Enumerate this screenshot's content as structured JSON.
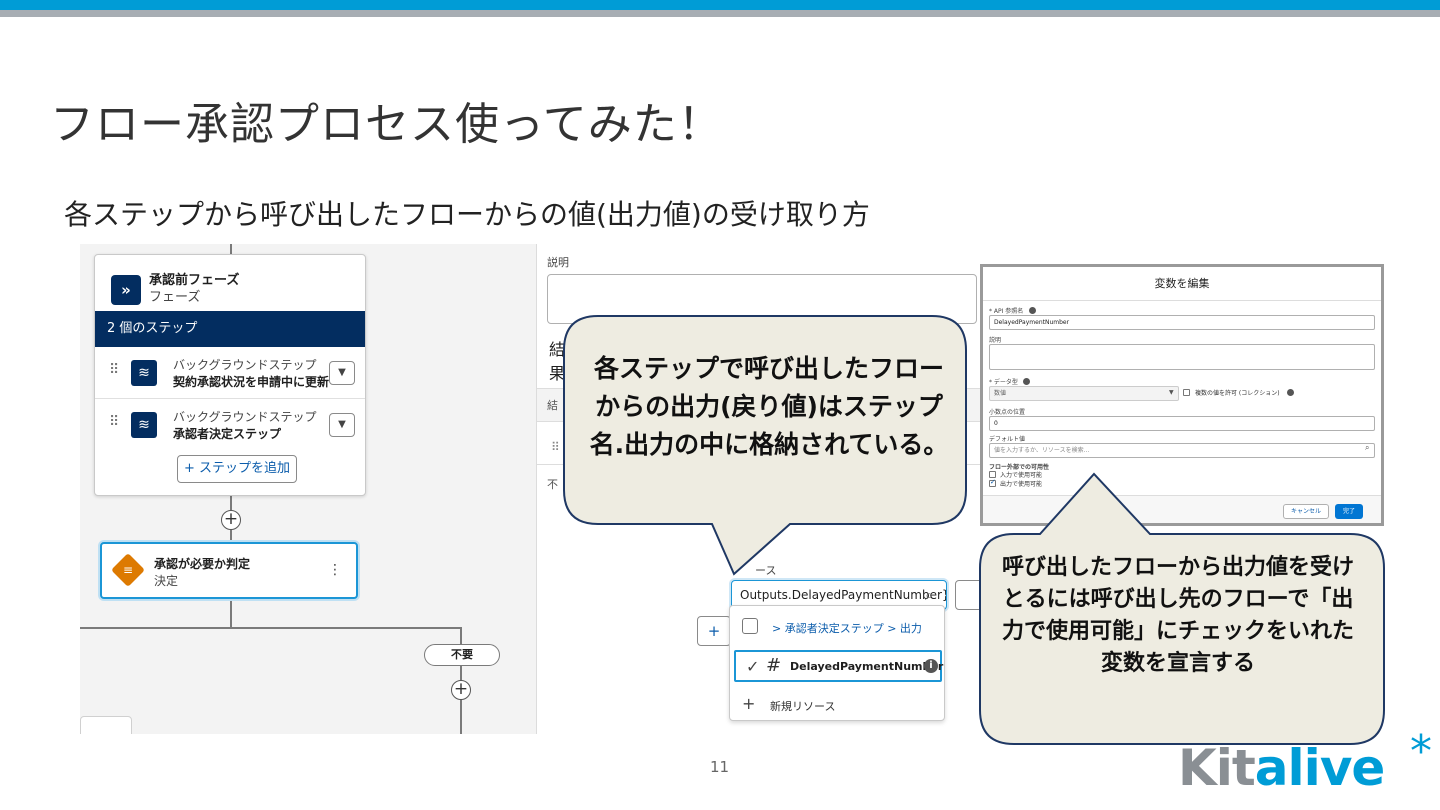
{
  "slide": {
    "title": "フロー承認プロセス使ってみた！",
    "subtitle": "各ステップから呼び出したフローからの値(出力値)の受け取り方",
    "page_number": "11"
  },
  "flow": {
    "phase": {
      "title": "承認前フェーズ",
      "type": "フェーズ",
      "icon": "chevron-double-icon",
      "steps_header": "2 個のステップ",
      "steps": [
        {
          "type": "バックグラウンドステップ",
          "name": "契約承認状況を申請中に更新"
        },
        {
          "type": "バックグラウンドステップ",
          "name": "承認者決定ステップ"
        }
      ],
      "add_step_label": "+ ステップを追加"
    },
    "decision": {
      "title": "承認が必要か判定",
      "type": "決定",
      "menu": "⋮"
    },
    "outcome_label": "不要"
  },
  "properties": {
    "description_label": "説明",
    "result_label_1": "結",
    "result_label_2": "果",
    "result_header": "結",
    "result_row": "不",
    "source_label": "ース",
    "source_value": "Outputs.DelayedPaymentNumber}",
    "add_label": "+",
    "dropdown": {
      "path": "> 承認者決定ステップ > 出力",
      "selected_var": "DelayedPaymentNumber",
      "new_resource": "新規リソース"
    }
  },
  "dialog": {
    "title": "変数を編集",
    "api_name_label": "* API 参照名",
    "api_name_value": "DelayedPaymentNumber",
    "description_label": "説明",
    "data_type_label": "* データ型",
    "data_type_value": "数値",
    "allow_multiple_label": "複数の値を許可 (コレクション)",
    "decimal_label": "小数点の位置",
    "decimal_value": "0",
    "default_label": "デフォルト値",
    "default_placeholder": "値を入力するか、リソースを検索...",
    "availability_label": "フロー外部での可用性",
    "available_input_label": "入力で使用可能",
    "available_output_label": "出力で使用可能",
    "available_input_checked": false,
    "available_output_checked": true,
    "cancel_label": "キャンセル",
    "done_label": "完了"
  },
  "callouts": {
    "callout1": "各ステップで呼び出したフローからの出力(戻り値)はステップ名.出力の中に格納されている。",
    "callout2": "呼び出したフローから出力値を受けとるには呼び出し先のフローで「出力で使用可能」にチェックをいれた変数を宣言する"
  },
  "logo": {
    "part1": "Kit",
    "part2": "alive",
    "star": "*"
  },
  "colors": {
    "accent_blue": "#009cd6",
    "navy": "#032d60",
    "callout_fill": "#eeece1",
    "callout_stroke": "#1f3864"
  }
}
